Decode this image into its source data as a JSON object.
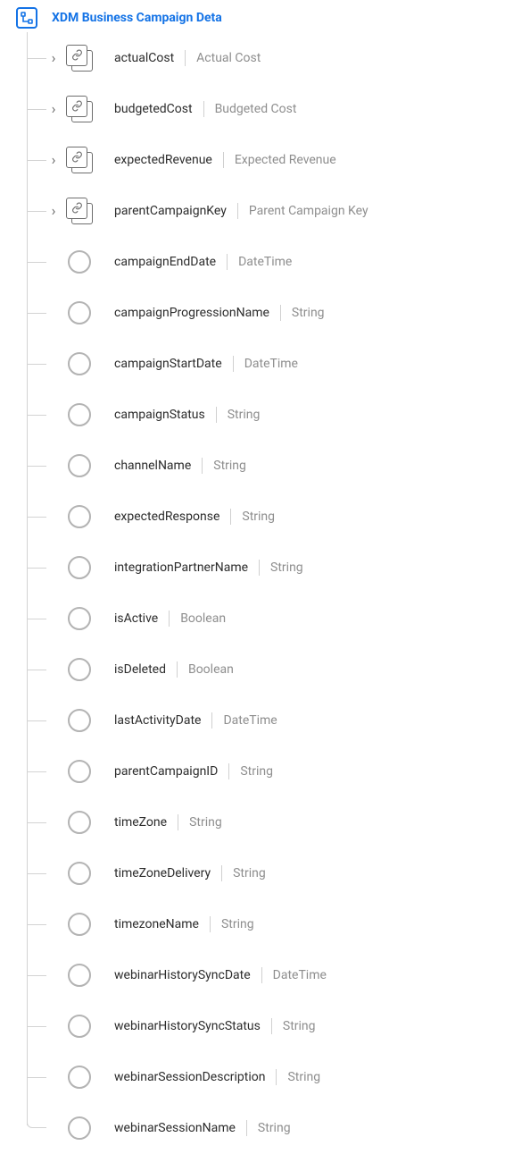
{
  "root": {
    "label": "XDM Business Campaign Deta"
  },
  "nodes": [
    {
      "name": "actualCost",
      "display": "Actual Cost",
      "iconType": "object",
      "expandable": true
    },
    {
      "name": "budgetedCost",
      "display": "Budgeted Cost",
      "iconType": "object",
      "expandable": true
    },
    {
      "name": "expectedRevenue",
      "display": "Expected Revenue",
      "iconType": "object",
      "expandable": true
    },
    {
      "name": "parentCampaignKey",
      "display": "Parent Campaign Key",
      "iconType": "object",
      "expandable": true
    },
    {
      "name": "campaignEndDate",
      "display": "DateTime",
      "iconType": "leaf",
      "expandable": false
    },
    {
      "name": "campaignProgressionName",
      "display": "String",
      "iconType": "leaf",
      "expandable": false
    },
    {
      "name": "campaignStartDate",
      "display": "DateTime",
      "iconType": "leaf",
      "expandable": false
    },
    {
      "name": "campaignStatus",
      "display": "String",
      "iconType": "leaf",
      "expandable": false
    },
    {
      "name": "channelName",
      "display": "String",
      "iconType": "leaf",
      "expandable": false
    },
    {
      "name": "expectedResponse",
      "display": "String",
      "iconType": "leaf",
      "expandable": false
    },
    {
      "name": "integrationPartnerName",
      "display": "String",
      "iconType": "leaf",
      "expandable": false
    },
    {
      "name": "isActive",
      "display": "Boolean",
      "iconType": "leaf",
      "expandable": false
    },
    {
      "name": "isDeleted",
      "display": "Boolean",
      "iconType": "leaf",
      "expandable": false
    },
    {
      "name": "lastActivityDate",
      "display": "DateTime",
      "iconType": "leaf",
      "expandable": false
    },
    {
      "name": "parentCampaignID",
      "display": "String",
      "iconType": "leaf",
      "expandable": false
    },
    {
      "name": "timeZone",
      "display": "String",
      "iconType": "leaf",
      "expandable": false
    },
    {
      "name": "timeZoneDelivery",
      "display": "String",
      "iconType": "leaf",
      "expandable": false
    },
    {
      "name": "timezoneName",
      "display": "String",
      "iconType": "leaf",
      "expandable": false
    },
    {
      "name": "webinarHistorySyncDate",
      "display": "DateTime",
      "iconType": "leaf",
      "expandable": false
    },
    {
      "name": "webinarHistorySyncStatus",
      "display": "String",
      "iconType": "leaf",
      "expandable": false
    },
    {
      "name": "webinarSessionDescription",
      "display": "String",
      "iconType": "leaf",
      "expandable": false
    },
    {
      "name": "webinarSessionName",
      "display": "String",
      "iconType": "leaf",
      "expandable": false
    }
  ]
}
